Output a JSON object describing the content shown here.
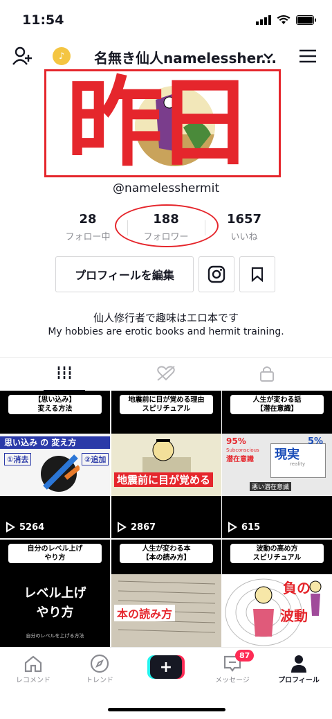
{
  "status_bar": {
    "time": "11:54"
  },
  "header": {
    "username_title": "名無き仙人namelessher..."
  },
  "overlay_text": {
    "k1": "昨",
    "k2": "日"
  },
  "profile": {
    "handle": "@namelesshermit",
    "stats": [
      {
        "num": "28",
        "label": "フォロー中"
      },
      {
        "num": "188",
        "label": "フォロワー"
      },
      {
        "num": "1657",
        "label": "いいね"
      }
    ],
    "edit_button": "プロフィールを編集",
    "bio_line1": "仙人修行者で趣味はエロ本です",
    "bio_line2": "My hobbies are erotic books and hermit training."
  },
  "videos": [
    {
      "caption": "【思い込み】\n変える方法",
      "views": "5264",
      "thumb_text": "思い込み の 変え方",
      "sub1": "①消去",
      "sub2": "②追加"
    },
    {
      "caption": "地震前に目が覚める理由\nスピリチュアル",
      "views": "2867",
      "thumb_text": "地震前に目が覚める"
    },
    {
      "caption": "人生が変わる話\n【潜在意識】",
      "views": "615",
      "thumb_text": "現実",
      "pct1": "95%",
      "pct2": "5%",
      "t1": "Subconscious",
      "t2": "潜在意識",
      "t3": "reality",
      "t4": "悪い潜在意識"
    },
    {
      "caption": "自分のレベル上げ\nやり方",
      "big": "レベル上げ\nやり方",
      "small": "自分のレベルを上げる方法"
    },
    {
      "caption": "人生が変わる本\n【本の読み方】",
      "thumb_text": "本の読み方"
    },
    {
      "caption": "波動の高め方\nスピリチュアル",
      "t1": "負の",
      "t2": "波動"
    }
  ],
  "nav": {
    "home": "レコメンド",
    "trend": "トレンド",
    "messages": "メッセージ",
    "messages_badge": "87",
    "profile": "プロフィール"
  },
  "colors": {
    "accent_red": "#e5262c",
    "tiktok_pink": "#fe2c55",
    "tiktok_cyan": "#25f4ee"
  }
}
